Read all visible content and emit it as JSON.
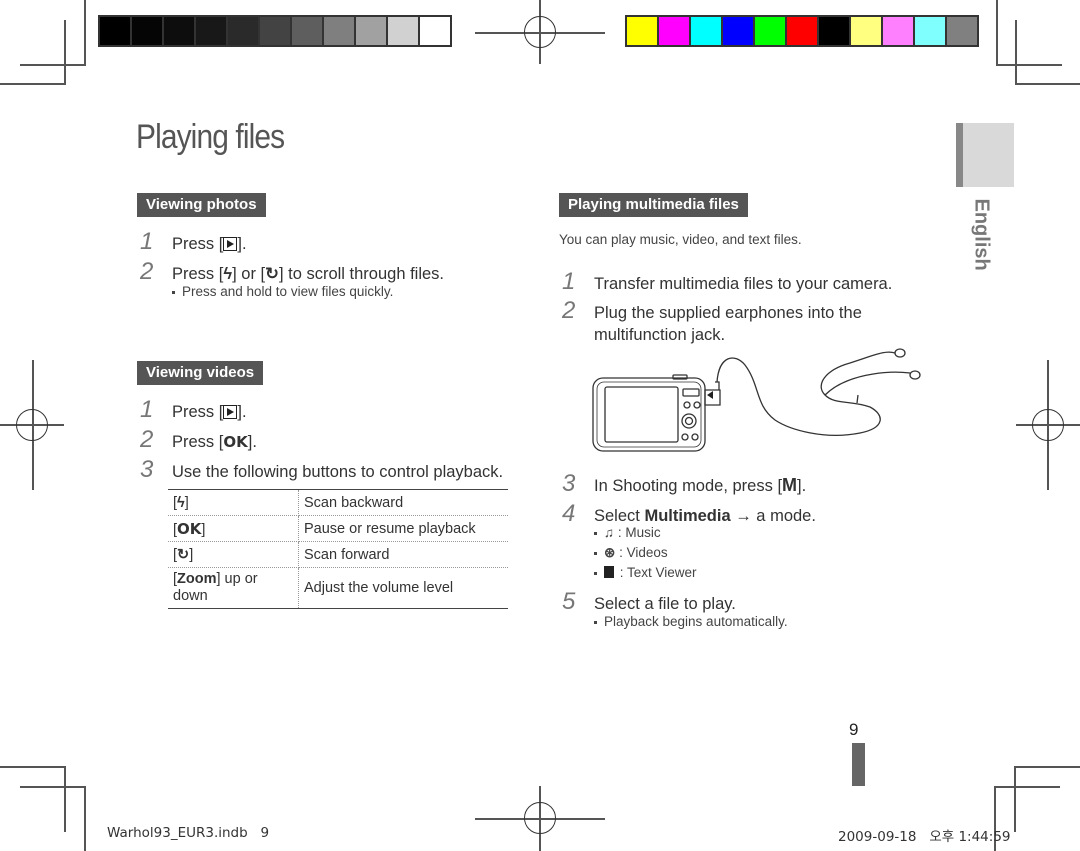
{
  "colors": {
    "grayscale_bar": [
      "#000000",
      "#050505",
      "#0d0d0d",
      "#181818",
      "#2a2a2a",
      "#434343",
      "#5e5e5e",
      "#7f7f7f",
      "#a1a1a1",
      "#d1d1d1",
      "#ffffff"
    ],
    "color_bar": [
      "#ffff00",
      "#ff00ff",
      "#00ffff",
      "#0000ff",
      "#00ff00",
      "#ff0000",
      "#000000",
      "#ffff80",
      "#ff80ff",
      "#80ffff",
      "#808080"
    ],
    "section_tag_bg": "#555555",
    "step_number": "#777777"
  },
  "page": {
    "title": "Playing files",
    "language_tab": "English",
    "page_number": "9"
  },
  "left": {
    "viewing_photos": {
      "heading": "Viewing photos",
      "steps": [
        {
          "num": "1",
          "pre": "Press [",
          "icon": "playback-icon",
          "post": "]."
        },
        {
          "num": "2",
          "pre": "Press [",
          "icon1": "flash-icon",
          "mid": "] or [",
          "icon2": "timer-icon",
          "post": "] to scroll through files."
        }
      ],
      "note": "Press and hold to view files quickly."
    },
    "viewing_videos": {
      "heading": "Viewing videos",
      "steps": [
        {
          "num": "1",
          "pre": "Press [",
          "icon": "playback-icon",
          "post": "]."
        },
        {
          "num": "2",
          "pre": "Press [",
          "key": "OK",
          "post": "]."
        },
        {
          "num": "3",
          "text": "Use the following buttons to control playback."
        }
      ],
      "table": [
        {
          "key_open": "[",
          "key_icon": "flash-icon",
          "key_close": "]",
          "action": "Scan backward"
        },
        {
          "key_open": "[",
          "key_text": "OK",
          "key_close": "]",
          "action": "Pause or resume playback"
        },
        {
          "key_open": "[",
          "key_icon": "timer-icon",
          "key_close": "]",
          "action": "Scan forward"
        },
        {
          "key_open": "[",
          "key_text": "Zoom",
          "key_close": "] up or down",
          "action": "Adjust the volume level"
        }
      ]
    }
  },
  "right": {
    "heading": "Playing multimedia files",
    "intro": "You can play music, video, and text files.",
    "steps": [
      {
        "num": "1",
        "text": "Transfer multimedia files to your camera."
      },
      {
        "num": "2",
        "text": "Plug the supplied earphones into the multifunction jack."
      },
      {
        "num": "3",
        "pre": "In Shooting mode, press [",
        "key": "M",
        "post": "]."
      },
      {
        "num": "4",
        "pre": "Select ",
        "bold": "Multimedia",
        "post": " → a mode."
      },
      {
        "num": "5",
        "text": "Select a file to play."
      }
    ],
    "modes": [
      {
        "icon": "music-icon",
        "label": ": Music"
      },
      {
        "icon": "video-reel-icon",
        "label": ": Videos"
      },
      {
        "icon": "text-viewer-icon",
        "label": ": Text Viewer"
      }
    ],
    "note": "Playback begins automatically.",
    "illustration": "camera-with-earphones"
  },
  "footer": {
    "file": "Warhol93_EUR3.indb   9",
    "timestamp": "2009-09-18   오후 1:44:59"
  }
}
